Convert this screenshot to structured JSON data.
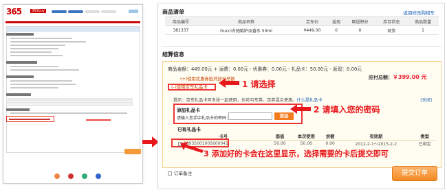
{
  "thumbnail": {
    "logo_main": "365",
    "logo_tag": "365buy"
  },
  "cart_section": {
    "title": "商品清单",
    "back_link": "返回修改购物车",
    "columns": [
      "商品编号",
      "商品名称",
      "京东价",
      "返现",
      "赠送积分",
      "库存状态",
      "商品数量"
    ],
    "rows": [
      {
        "id": "381337",
        "name": "Gucci古驰嫉妒淡香水 50ml",
        "price": "¥449.00",
        "rebate": "0",
        "points": "0",
        "stock": "现货",
        "qty": "1"
      }
    ]
  },
  "checkout_section": {
    "title": "结算信息",
    "summary": "商品金额：449.00元 + 运费：0.00元 - 优惠券：0.00元 - 礼品卡：50.00元 - 返现：0.00元",
    "coupon_link": "(+)使用优惠券抵消部分总额",
    "payable_label": "应付总额：",
    "payable_amount": "￥399.00 元",
    "giftcard_link": "(-)使用京东礼品卡",
    "note": "提示：京东礼品卡可多张一起使用，也可与东券、京券混合使用。",
    "note_help": "什么是礼品卡",
    "close": "[关闭]",
    "add_box": {
      "title": "添加礼品卡",
      "input_label": "请输入您手中礼品卡的密码：",
      "input_value": "",
      "add_button": "添加"
    },
    "have_title": "已有礼品卡",
    "card_columns": [
      "卡号",
      "面值",
      "本次使用",
      "余额",
      "有效期",
      "类型"
    ],
    "cards": [
      {
        "number": "18935001005600041",
        "face": "50.00",
        "use": "50.00",
        "balance": "0.00",
        "valid": "2012-2-1～2015-2-2",
        "type": "已绑定"
      }
    ],
    "remark": "订单备注",
    "submit": "提交订单"
  },
  "annotations": {
    "step1": "1 请选择",
    "step2": "2 请填入您的密码",
    "step3": "3 添加好的卡会在这里显示，选择需要的卡后提交即可"
  },
  "colors": {
    "annotation": "#e8181c",
    "accent": "#f28a24",
    "link": "#1a5fb4"
  }
}
